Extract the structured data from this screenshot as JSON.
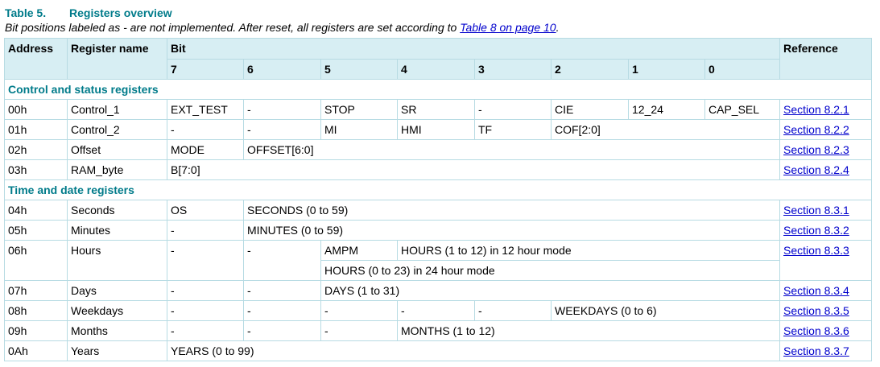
{
  "caption": {
    "table_number": "Table 5.",
    "table_title": "Registers overview",
    "note_prefix": "Bit positions labeled as - are not implemented. After reset, all registers are set according to ",
    "note_link": "Table 8 on page 10",
    "note_suffix": "."
  },
  "header": {
    "address": "Address",
    "register_name": "Register name",
    "bit": "Bit",
    "reference": "Reference",
    "bits": [
      "7",
      "6",
      "5",
      "4",
      "3",
      "2",
      "1",
      "0"
    ]
  },
  "sections": {
    "control": "Control and status registers",
    "time": "Time and date registers"
  },
  "rows": {
    "r00": {
      "addr": "00h",
      "name": "Control_1",
      "b7": "EXT_TEST",
      "b6": "-",
      "b5": "STOP",
      "b4": "SR",
      "b3": "-",
      "b2": "CIE",
      "b1": "12_24",
      "b0": "CAP_SEL",
      "ref": "Section 8.2.1"
    },
    "r01": {
      "addr": "01h",
      "name": "Control_2",
      "b7": "-",
      "b6": "-",
      "b5": "MI",
      "b4": "HMI",
      "b3": "TF",
      "b2_0": "COF[2:0]",
      "ref": "Section 8.2.2"
    },
    "r02": {
      "addr": "02h",
      "name": "Offset",
      "b7": "MODE",
      "b6_0": "OFFSET[6:0]",
      "ref": "Section 8.2.3"
    },
    "r03": {
      "addr": "03h",
      "name": "RAM_byte",
      "b7_0": "B[7:0]",
      "ref": "Section 8.2.4"
    },
    "r04": {
      "addr": "04h",
      "name": "Seconds",
      "b7": "OS",
      "b6_0": "SECONDS (0 to 59)",
      "ref": "Section 8.3.1"
    },
    "r05": {
      "addr": "05h",
      "name": "Minutes",
      "b7": "-",
      "b6_0": "MINUTES (0 to 59)",
      "ref": "Section 8.3.2"
    },
    "r06": {
      "addr": "06h",
      "name": "Hours",
      "b7": "-",
      "b6": "-",
      "b5": "AMPM",
      "b4_0": "HOURS (1 to 12) in 12 hour mode",
      "b5_0": "HOURS (0 to 23) in 24 hour mode",
      "ref": "Section 8.3.3"
    },
    "r07": {
      "addr": "07h",
      "name": "Days",
      "b7": "-",
      "b6": "-",
      "b5_0": "DAYS (1 to 31)",
      "ref": "Section 8.3.4"
    },
    "r08": {
      "addr": "08h",
      "name": "Weekdays",
      "b7": "-",
      "b6": "-",
      "b5": "-",
      "b4": "-",
      "b3": "-",
      "b2_0": "WEEKDAYS (0 to 6)",
      "ref": "Section 8.3.5"
    },
    "r09": {
      "addr": "09h",
      "name": "Months",
      "b7": "-",
      "b6": "-",
      "b5": "-",
      "b4_0": "MONTHS (1 to 12)",
      "ref": "Section 8.3.6"
    },
    "r0A": {
      "addr": "0Ah",
      "name": "Years",
      "b7_0": "YEARS (0 to 99)",
      "ref": "Section 8.3.7"
    }
  }
}
